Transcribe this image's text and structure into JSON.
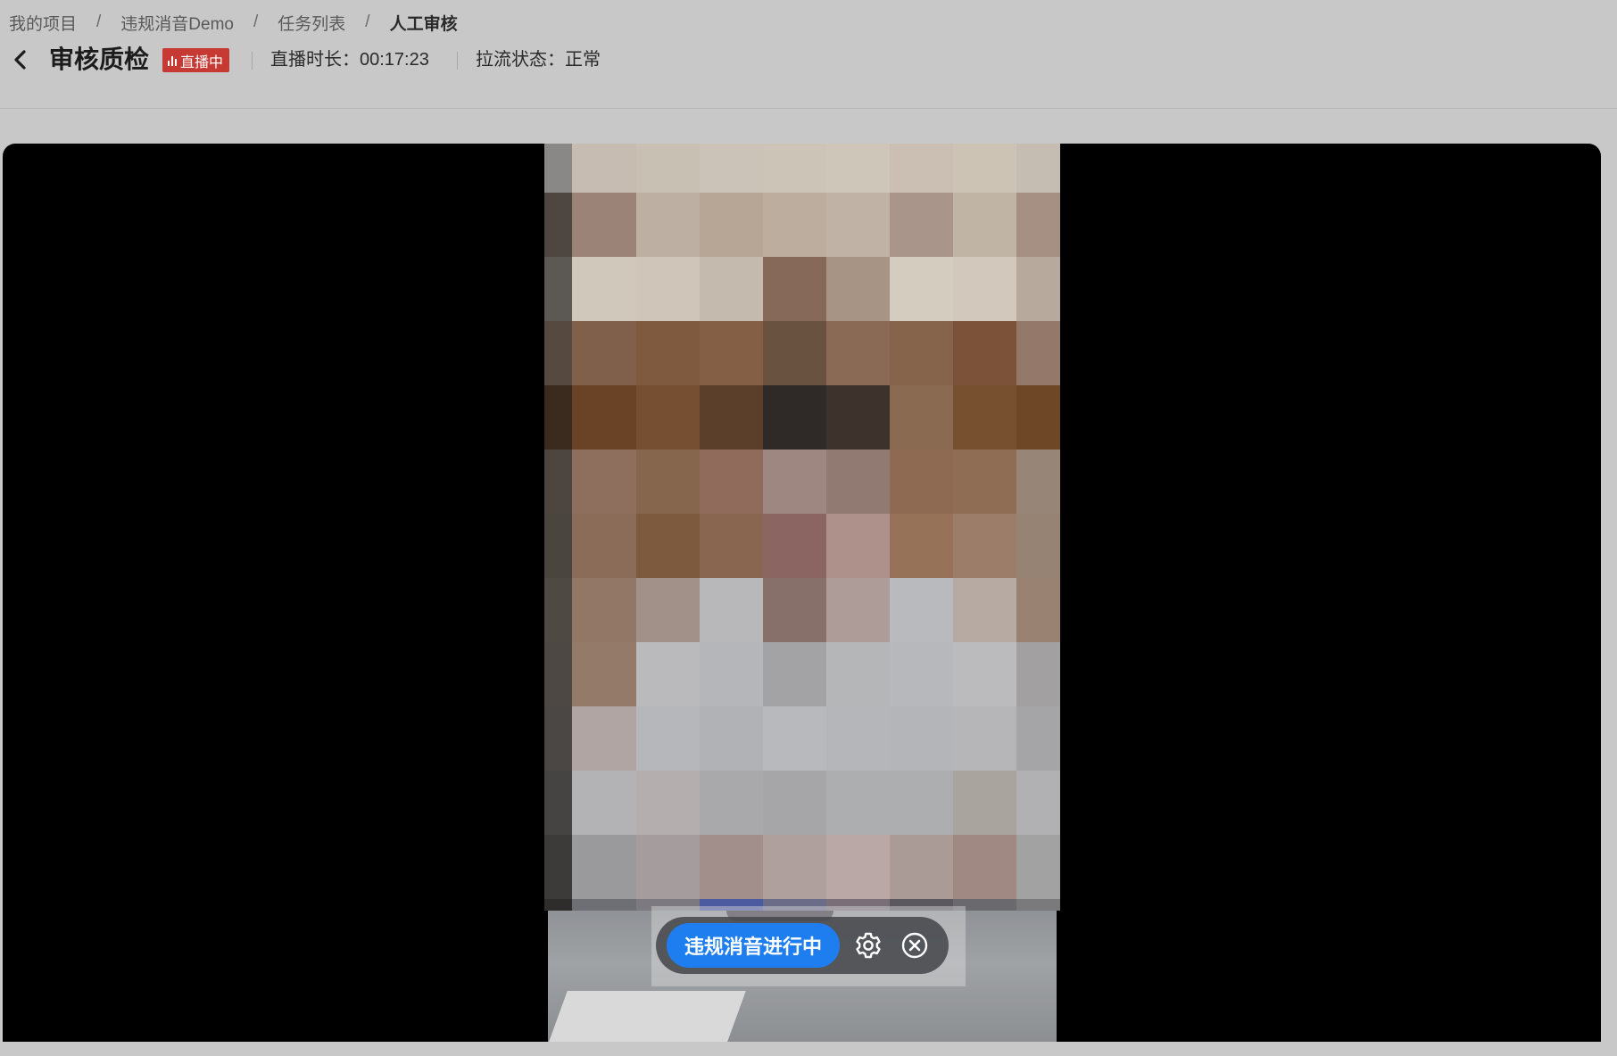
{
  "breadcrumb": {
    "items": [
      "我的项目",
      "违规消音Demo",
      "任务列表",
      "人工审核"
    ],
    "separator": "/"
  },
  "header": {
    "back_icon": "chevron-left-icon",
    "title": "审核质检",
    "live_badge": "直播中",
    "duration_label": "直播时长：",
    "duration_value": "00:17:23",
    "stream_status_label": "拉流状态：",
    "stream_status_value": "正常"
  },
  "player": {
    "mute_status_button": "违规消音进行中",
    "settings_icon": "gear-icon",
    "close_icon": "close-circle-icon"
  },
  "colors": {
    "background": "#c8c8c8",
    "badge_red": "#c73a33",
    "accent_blue": "#1e7ef0",
    "player_bg": "#000000"
  }
}
